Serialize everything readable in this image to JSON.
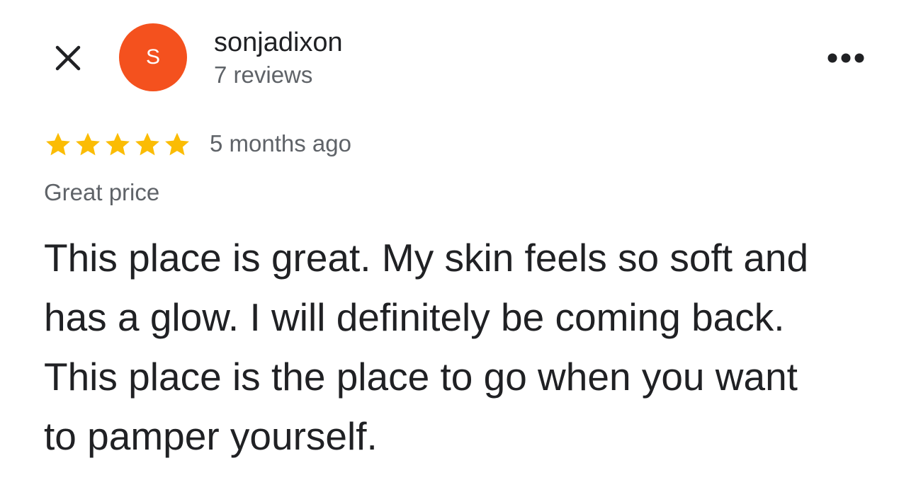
{
  "reviewer": {
    "initial": "S",
    "avatar_color": "#f4511e",
    "name": "sonjadixon",
    "review_count": "7 reviews"
  },
  "icons": {
    "close": "close-icon",
    "more": "more-horizontal-icon",
    "star": "star-icon"
  },
  "review": {
    "rating": 5,
    "rating_max": 5,
    "star_color": "#fbbc04",
    "time": "5 months ago",
    "title": "Great price",
    "body_lines": [
      "This place is great. My skin feels so soft and",
      "has a glow. I will definitely be coming back.",
      "This place is the place to go when you want",
      "to pamper yourself."
    ]
  }
}
